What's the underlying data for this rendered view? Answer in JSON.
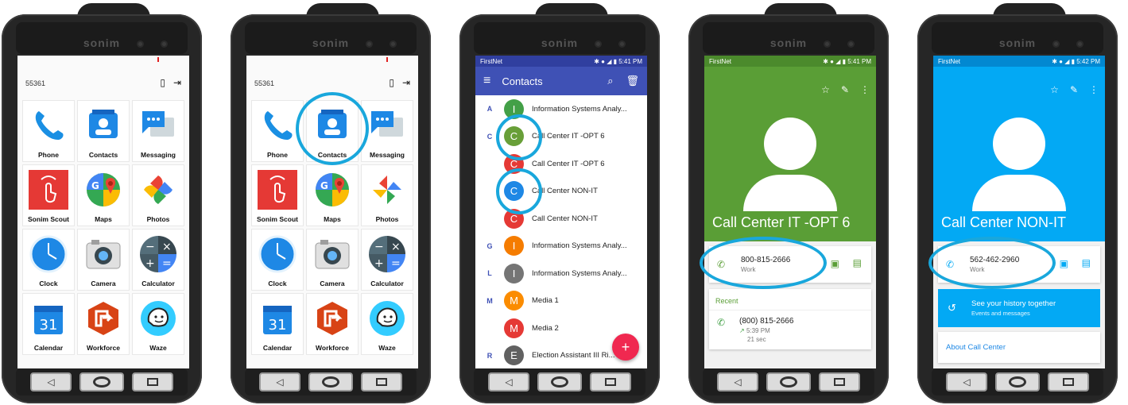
{
  "brand": "sonim",
  "colors": {
    "highlight": "#19a7dc",
    "contacts_toolbar": "#3f51b5",
    "detail1_theme": "#5a9e36",
    "detail2_theme": "#03a9f4",
    "fab": "#f02850"
  },
  "home": {
    "code": "55361",
    "status_icons": [
      "sim-icon",
      "exit-icon"
    ],
    "apps": [
      {
        "label": "Phone",
        "icon": "phone-icon"
      },
      {
        "label": "Contacts",
        "icon": "contacts-icon"
      },
      {
        "label": "Messaging",
        "icon": "messaging-icon"
      },
      {
        "label": "Sonim Scout",
        "icon": "sonim-scout-icon"
      },
      {
        "label": "Maps",
        "icon": "maps-icon"
      },
      {
        "label": "Photos",
        "icon": "photos-icon"
      },
      {
        "label": "Clock",
        "icon": "clock-icon"
      },
      {
        "label": "Camera",
        "icon": "camera-icon"
      },
      {
        "label": "Calculator",
        "icon": "calculator-icon"
      },
      {
        "label": "Calendar",
        "icon": "calendar-icon",
        "day": "31"
      },
      {
        "label": "Workforce",
        "icon": "workforce-icon"
      },
      {
        "label": "Waze",
        "icon": "waze-icon"
      }
    ]
  },
  "contacts": {
    "status": {
      "carrier": "FirstNet",
      "time": "5:41 PM"
    },
    "title": "Contacts",
    "rows": [
      {
        "letter": "A",
        "initial": "I",
        "color": "#43a047",
        "name": "Information Systems Analy..."
      },
      {
        "letter": "C",
        "initial": "C",
        "color": "#689f38",
        "name": "Call Center IT -OPT 6"
      },
      {
        "letter": "",
        "initial": "C",
        "color": "#e53935",
        "name": "Call Center IT -OPT 6"
      },
      {
        "letter": "",
        "initial": "C",
        "color": "#1e88e5",
        "name": "Call Center NON-IT"
      },
      {
        "letter": "",
        "initial": "C",
        "color": "#e53935",
        "name": "Call Center NON-IT"
      },
      {
        "letter": "G",
        "initial": "I",
        "color": "#f57c00",
        "name": "Information Systems Analy..."
      },
      {
        "letter": "L",
        "initial": "I",
        "color": "#757575",
        "name": "Information Systems Analy..."
      },
      {
        "letter": "M",
        "initial": "M",
        "color": "#fb8c00",
        "name": "Media 1"
      },
      {
        "letter": "",
        "initial": "M",
        "color": "#e53935",
        "name": "Media 2"
      },
      {
        "letter": "R",
        "initial": "E",
        "color": "#616161",
        "name": "Election Assistant III Ri..."
      }
    ],
    "fab": "+"
  },
  "detail1": {
    "status": {
      "carrier": "FirstNet",
      "time": "5:41 PM"
    },
    "name": "Call Center IT -OPT 6",
    "number": "800-815-2666",
    "number_type": "Work",
    "recent_label": "Recent",
    "recent_number": "(800) 815-2666",
    "recent_time": "5:39 PM",
    "recent_duration": "21 sec"
  },
  "detail2": {
    "status": {
      "carrier": "FirstNet",
      "time": "5:42 PM"
    },
    "name": "Call Center NON-IT",
    "number": "562-462-2960",
    "number_type": "Work",
    "history_title": "See your history together",
    "history_sub": "Events and messages",
    "about": "About Call Center"
  }
}
